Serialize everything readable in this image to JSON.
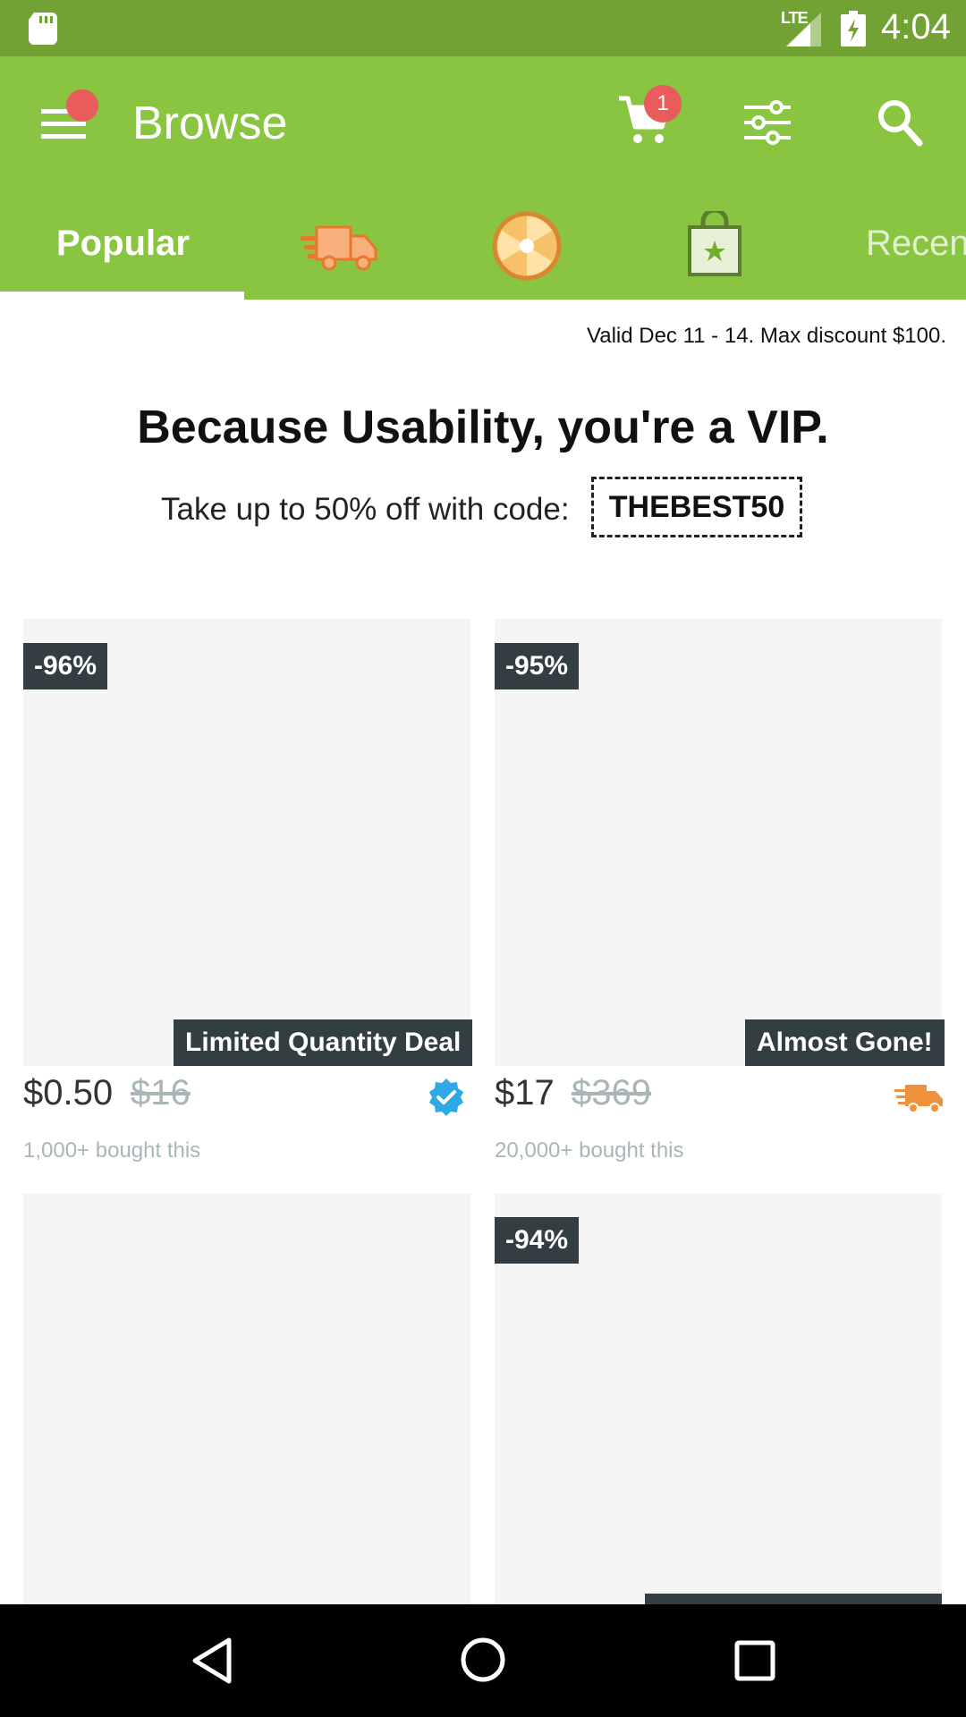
{
  "status_bar": {
    "time": "4:04",
    "network": "LTE",
    "icons": [
      "sd-card-icon",
      "signal-icon",
      "battery-charging-icon"
    ]
  },
  "app_bar": {
    "title": "Browse",
    "cart_count": "1",
    "icons": [
      "menu-icon",
      "cart-icon",
      "filter-icon",
      "search-icon"
    ]
  },
  "tabs": [
    {
      "label": "Popular",
      "selected": true
    },
    {
      "icon": "delivery-truck-icon"
    },
    {
      "icon": "spin-wheel-icon"
    },
    {
      "icon": "shopping-bag-star-icon"
    },
    {
      "label": "Recen"
    }
  ],
  "promo": {
    "valid_text": "Valid Dec 11 - 14. Max discount $100.",
    "headline": "Because Usability, you're a VIP.",
    "code_text": "Take up to 50% off with code:",
    "code": "THEBEST50"
  },
  "deals": [
    {
      "discount": "-96%",
      "tag": "Limited Quantity Deal",
      "price": "$0.50",
      "original_price": "$16",
      "bought": "1,000+ bought this",
      "icon": "verified-check-icon"
    },
    {
      "discount": "-95%",
      "tag": "Almost Gone!",
      "price": "$17",
      "original_price": "$369",
      "bought": "20,000+ bought this",
      "icon": "fast-shipping-icon"
    },
    {
      "discount": "",
      "tag": "",
      "price": "",
      "original_price": "",
      "bought": ""
    },
    {
      "discount": "-94%",
      "tag": "",
      "price": "",
      "original_price": "",
      "bought": ""
    }
  ],
  "colors": {
    "status_bar": "#72a233",
    "app_bar": "#89c541",
    "badge": "#ea5b5b",
    "tag_bg": "#333e42",
    "muted_text": "#a9b6b8",
    "verified": "#2fa9e6",
    "shipping": "#f0923d"
  }
}
